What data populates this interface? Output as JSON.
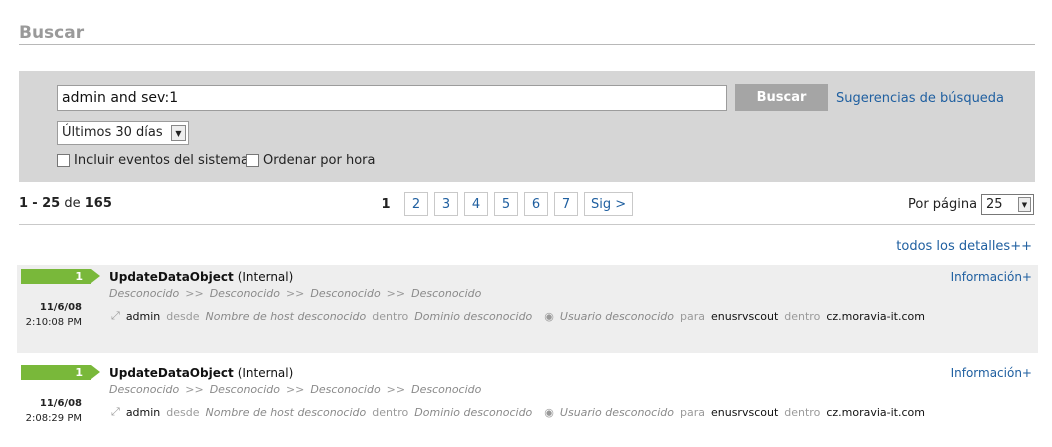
{
  "page": {
    "title": "Buscar"
  },
  "search": {
    "query_value": "admin and sev:1",
    "button_label": "Buscar",
    "suggestions_link": "Sugerencias de búsqueda",
    "range_selected": "Últimos 30 días",
    "checkbox_system_events": "Incluir eventos del sistema",
    "checkbox_order_by_time": "Ordenar por hora"
  },
  "results": {
    "range_start": "1",
    "range_end": "25",
    "of_label": "de",
    "total": "165",
    "current_page": "1",
    "pages": [
      "2",
      "3",
      "4",
      "5",
      "6",
      "7"
    ],
    "next_label": "Sig >",
    "per_page_label": "Por página",
    "per_page_value": "25",
    "all_details_link": "todos los detalles++"
  },
  "events": [
    {
      "severity": "1",
      "date": "11/6/08",
      "time": "2:10:08 PM",
      "name": "UpdateDataObject",
      "type": "(Internal)",
      "path": [
        "Desconocido",
        "Desconocido",
        "Desconocido",
        "Desconocido"
      ],
      "path_sep": ">>",
      "initiator": "admin",
      "from_label": "desde",
      "host": "Nombre de host desconocido",
      "within_label": "dentro",
      "domain": "Dominio desconocido",
      "target_user": "Usuario desconocido",
      "for_label": "para",
      "target_host": "enusrvscout",
      "target_within_label": "dentro",
      "target_domain": "cz.moravia-it.com",
      "info_link": "Información+"
    },
    {
      "severity": "1",
      "date": "11/6/08",
      "time": "2:08:29 PM",
      "name": "UpdateDataObject",
      "type": "(Internal)",
      "path": [
        "Desconocido",
        "Desconocido",
        "Desconocido",
        "Desconocido"
      ],
      "path_sep": ">>",
      "initiator": "admin",
      "from_label": "desde",
      "host": "Nombre de host desconocido",
      "within_label": "dentro",
      "domain": "Dominio desconocido",
      "target_user": "Usuario desconocido",
      "for_label": "para",
      "target_host": "enusrvscout",
      "target_within_label": "dentro",
      "target_domain": "cz.moravia-it.com",
      "info_link": "Información+"
    }
  ],
  "colors": {
    "severity_low": "#79b83a",
    "link": "#1f5fa0",
    "panel_bg": "#d6d6d6"
  },
  "icons": {
    "initiator": "user-arrow-icon",
    "target": "target-circle-icon"
  }
}
